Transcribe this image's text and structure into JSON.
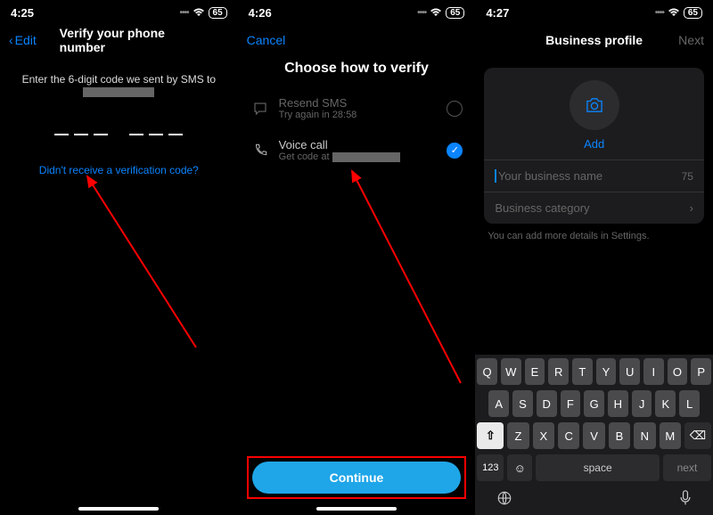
{
  "status": {
    "battery": "65"
  },
  "screen1": {
    "time": "4:25",
    "edit": "Edit",
    "title": "Verify your phone number",
    "instruction": "Enter the 6-digit code we sent by SMS to",
    "link": "Didn't receive a verification code?"
  },
  "screen2": {
    "time": "4:26",
    "cancel": "Cancel",
    "title": "Choose how to verify",
    "options": {
      "sms": {
        "title": "Resend SMS",
        "sub": "Try again in 28:58"
      },
      "call": {
        "title": "Voice call",
        "sub_prefix": "Get code at "
      }
    },
    "continue": "Continue"
  },
  "screen3": {
    "time": "4:27",
    "title": "Business profile",
    "next": "Next",
    "add": "Add",
    "name_placeholder": "Your business name",
    "name_limit": "75",
    "category": "Business category",
    "hint": "You can add more details in Settings."
  },
  "keyboard": {
    "row1": [
      "Q",
      "W",
      "E",
      "R",
      "T",
      "Y",
      "U",
      "I",
      "O",
      "P"
    ],
    "row2": [
      "A",
      "S",
      "D",
      "F",
      "G",
      "H",
      "J",
      "K",
      "L"
    ],
    "row3": [
      "Z",
      "X",
      "C",
      "V",
      "B",
      "N",
      "M"
    ],
    "num": "123",
    "space": "space",
    "next": "next"
  }
}
